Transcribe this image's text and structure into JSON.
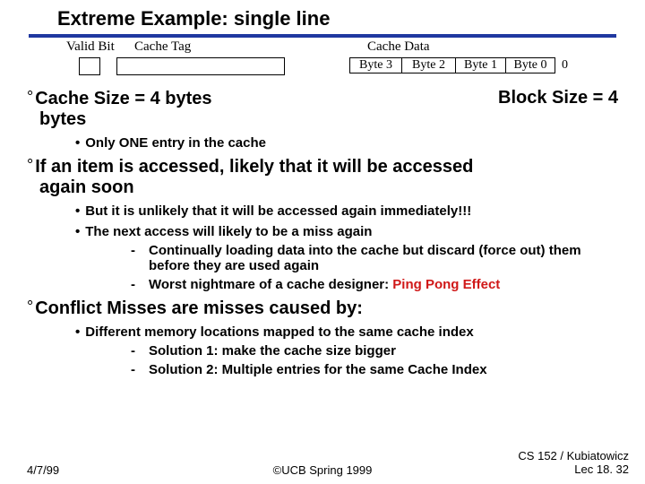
{
  "title": "Extreme Example: single line",
  "labels": {
    "valid": "Valid Bit",
    "tag": "Cache Tag",
    "data": "Cache Data"
  },
  "cells": {
    "b3": "Byte 3",
    "b2": "Byte 2",
    "b1": "Byte 1",
    "b0": "Byte 0"
  },
  "trailing_zero": "0",
  "p1_left_a": "Cache Size = 4 bytes",
  "p1_right": "Block Size = 4",
  "p1_left_b": "bytes",
  "b2_1": "Only ONE entry in the cache",
  "p2_a": "If an item is accessed, likely  that it will be accessed",
  "p2_b": "again soon",
  "b2_2": "But it is unlikely that it will be accessed again immediately!!!",
  "b2_3": "The next access will likely to be a miss again",
  "b3_1": "Continually loading data into the cache but discard (force out) them before they are used again",
  "b3_2a": "Worst nightmare of a cache designer: ",
  "b3_2b": "Ping Pong Effect",
  "p3": "Conflict Misses are misses caused by:",
  "b2_4": "Different memory locations  mapped to the same cache index",
  "b3_3": "Solution 1: make the cache size bigger",
  "b3_4": "Solution 2: Multiple entries for the same Cache Index",
  "footer": {
    "date": "4/7/99",
    "center": "©UCB Spring 1999",
    "right1": "CS 152 / Kubiatowicz",
    "right2": "Lec 18. 32"
  },
  "glyph": {
    "deg": "°",
    "dot": "•",
    "dash": "-"
  }
}
